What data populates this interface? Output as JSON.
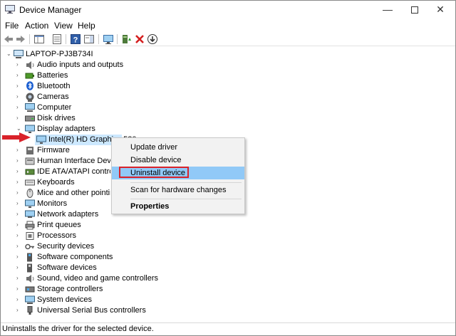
{
  "window": {
    "title": "Device Manager"
  },
  "title_buttons": {
    "minimize": "—",
    "close": "✕"
  },
  "menu": [
    "File",
    "Action",
    "View",
    "Help"
  ],
  "tree": {
    "root": "LAPTOP-PJ3B734I",
    "categories": [
      "Audio inputs and outputs",
      "Batteries",
      "Bluetooth",
      "Cameras",
      "Computer",
      "Disk drives",
      "Display adapters",
      "Intel(R) HD Graphics 520",
      "Firmware",
      "Human Interface Devices",
      "IDE ATA/ATAPI controllers",
      "Keyboards",
      "Mice and other pointing devices",
      "Monitors",
      "Network adapters",
      "Print queues",
      "Processors",
      "Security devices",
      "Software components",
      "Software devices",
      "Sound, video and game controllers",
      "Storage controllers",
      "System devices",
      "Universal Serial Bus controllers"
    ]
  },
  "context_menu": {
    "items": [
      "Update driver",
      "Disable device",
      "Uninstall device",
      "Scan for hardware changes",
      "Properties"
    ]
  },
  "status": "Uninstalls the driver for the selected device.",
  "colors": {
    "selection": "#cce8ff",
    "menu_highlight": "#91c9f7",
    "annotation_red": "#d9222a"
  }
}
